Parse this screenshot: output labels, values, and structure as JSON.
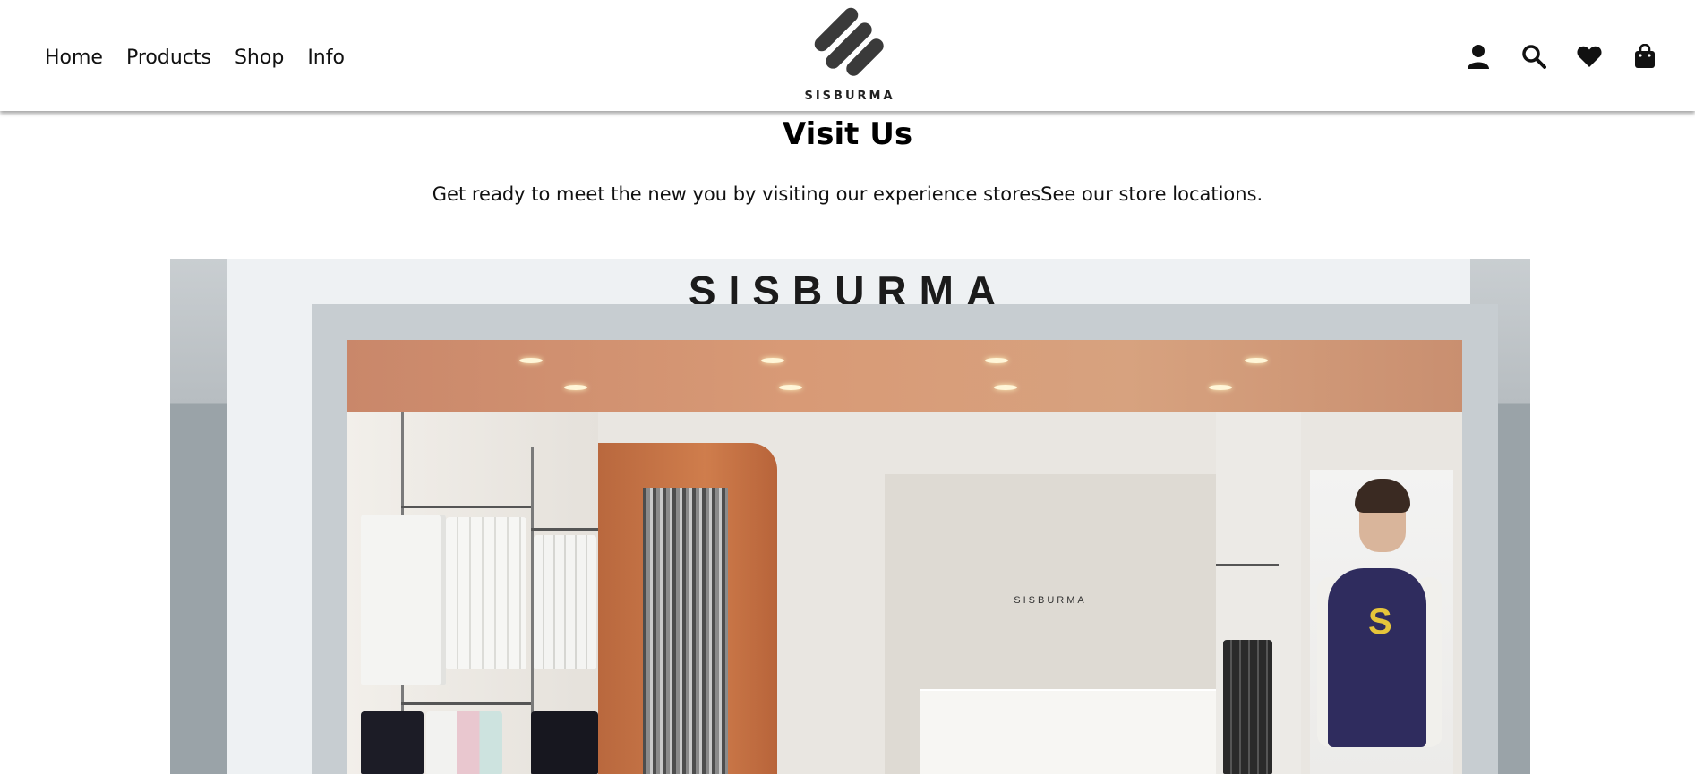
{
  "brand": {
    "logo_text": "SISBURMA"
  },
  "nav": {
    "items": [
      {
        "label": "Home"
      },
      {
        "label": "Products"
      },
      {
        "label": "Shop"
      },
      {
        "label": "Info"
      }
    ]
  },
  "header_icons": [
    {
      "icon": "user-icon"
    },
    {
      "icon": "search-icon"
    },
    {
      "icon": "heart-icon"
    },
    {
      "icon": "shopping-bag-icon"
    }
  ],
  "main": {
    "title": "Visit Us",
    "subtitle": "Get ready to meet the new you by visiting our experience storesSee our store locations."
  },
  "store_image": {
    "sign_text": "SISBURMA",
    "wall_text": "SISBURMA"
  },
  "colors": {
    "text": "#111111",
    "store_orange": "#cf7d4c",
    "store_grey": "#9aa3a8"
  }
}
